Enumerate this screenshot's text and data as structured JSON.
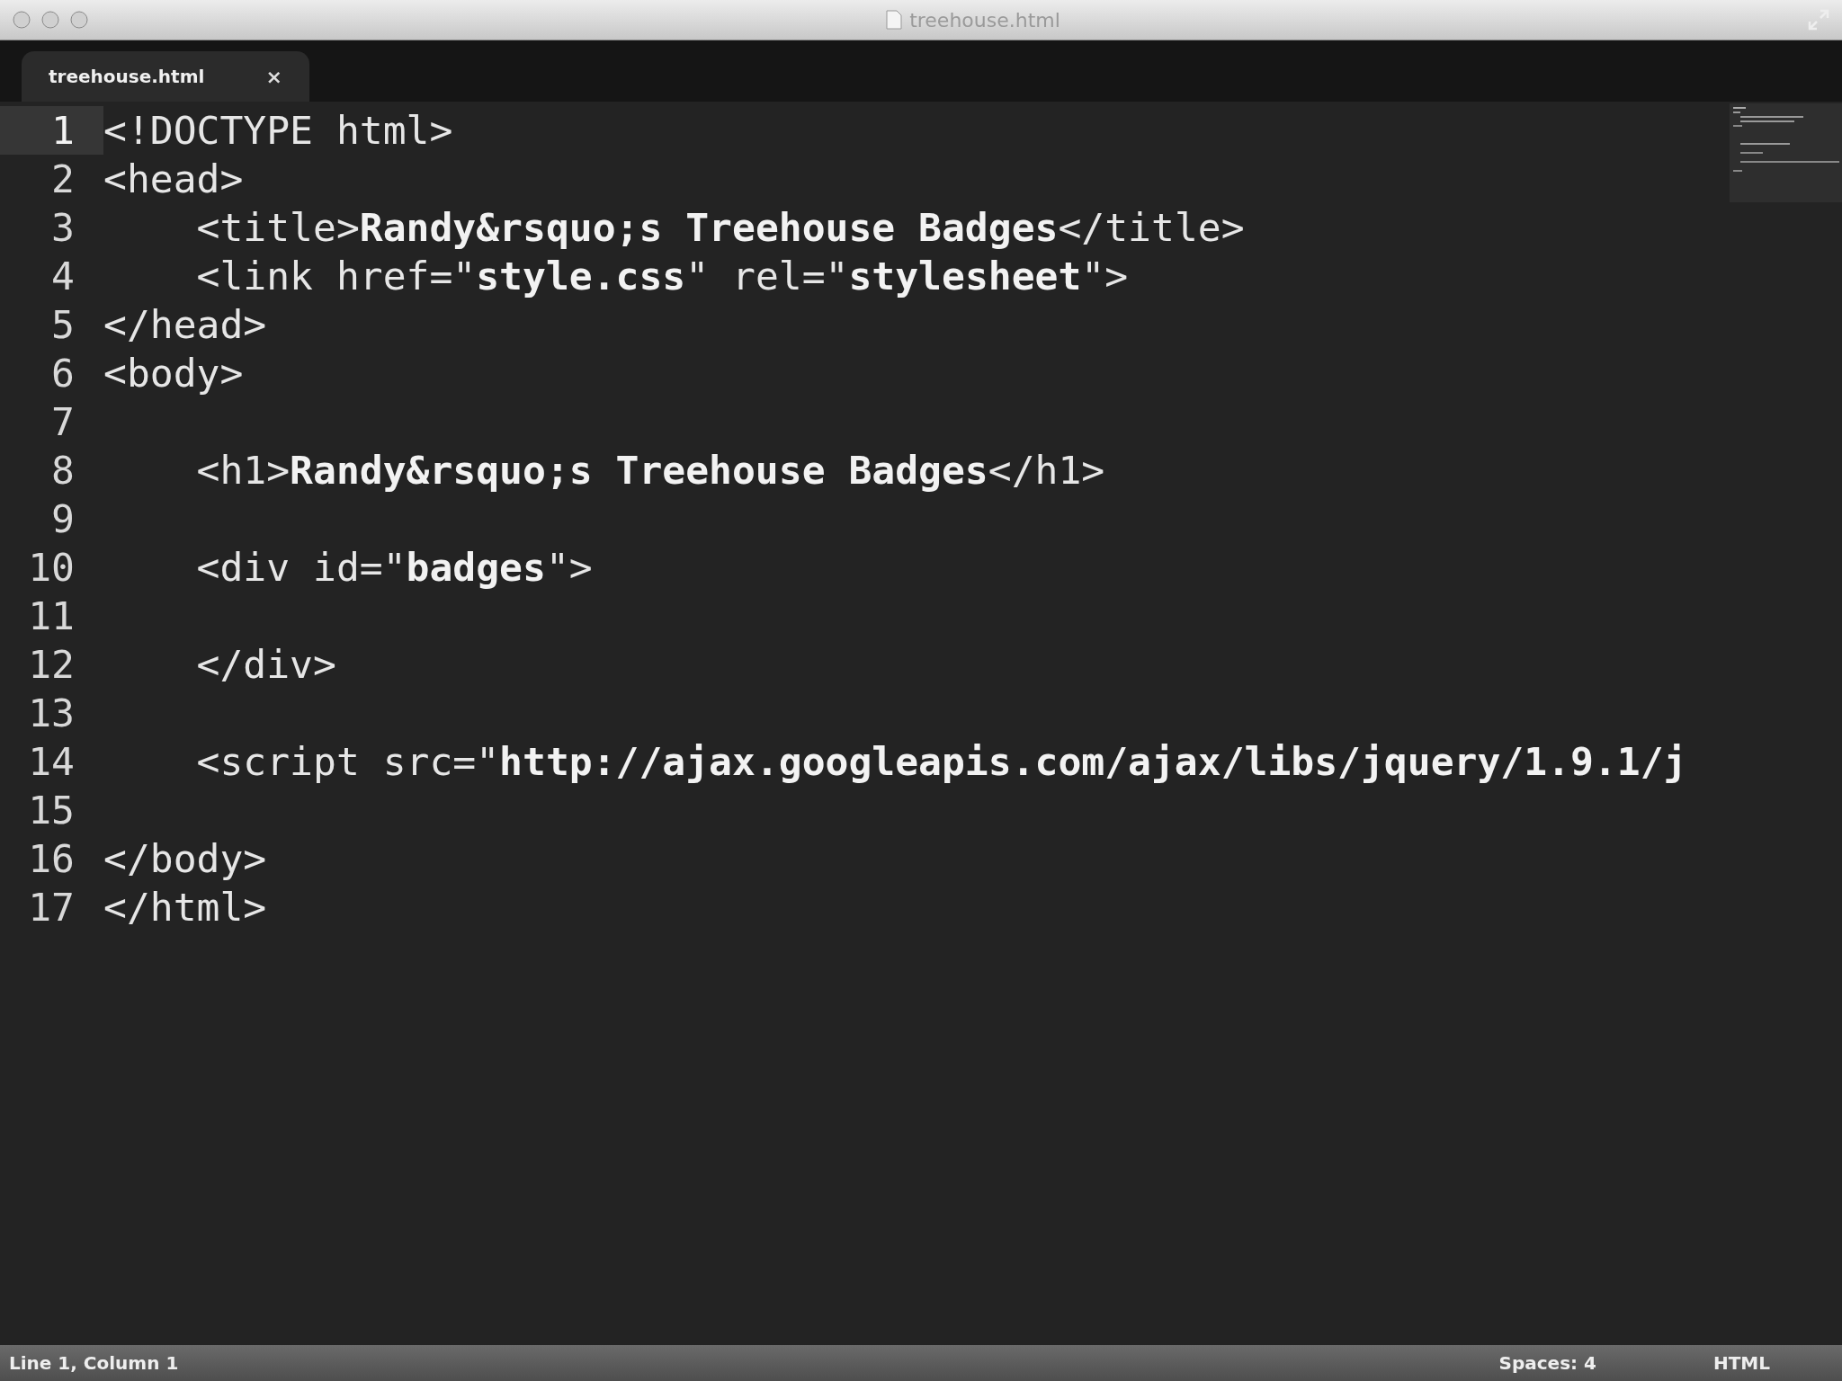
{
  "window": {
    "title": "treehouse.html"
  },
  "tabs": [
    {
      "label": "treehouse.html",
      "close": "×",
      "selected": true
    }
  ],
  "editor": {
    "lines": [
      {
        "number": "1",
        "text": "<!DOCTYPE html>",
        "selected": true
      },
      {
        "number": "2",
        "text": "<head>",
        "selected": false
      },
      {
        "number": "3",
        "text": "    <title>**Randy&rsquo;s Treehouse Badges**</title>",
        "selected": false
      },
      {
        "number": "4",
        "text": "    <link href=\"**style.css**\" rel=\"**stylesheet**\">",
        "selected": false
      },
      {
        "number": "5",
        "text": "</head>",
        "selected": false
      },
      {
        "number": "6",
        "text": "<body>",
        "selected": false
      },
      {
        "number": "7",
        "selected": false
      },
      {
        "number": "8",
        "text": "    <h1>**Randy&rsquo;s Treehouse Badges**</h1>",
        "selected": false
      },
      {
        "number": "9",
        "selected": false
      },
      {
        "number": "10",
        "text": "    <div id=\"**badges**\">",
        "selected": false
      },
      {
        "number": "11",
        "selected": false
      },
      {
        "number": "12",
        "text": "    </div>",
        "selected": false
      },
      {
        "number": "13",
        "selected": false
      },
      {
        "number": "14",
        "text": "    <script src=\"**http://ajax.googleapis.com/ajax/libs/jquery/1.9.1/j**",
        "selected": false
      },
      {
        "number": "15",
        "selected": false
      },
      {
        "number": "16",
        "text": "</body>",
        "selected": false
      },
      {
        "number": "17",
        "text": "</html>",
        "selected": false
      }
    ]
  },
  "status_bar": {
    "position": "Line 1, Column 1",
    "indentation": "Spaces: 4",
    "syntax": "HTML"
  }
}
